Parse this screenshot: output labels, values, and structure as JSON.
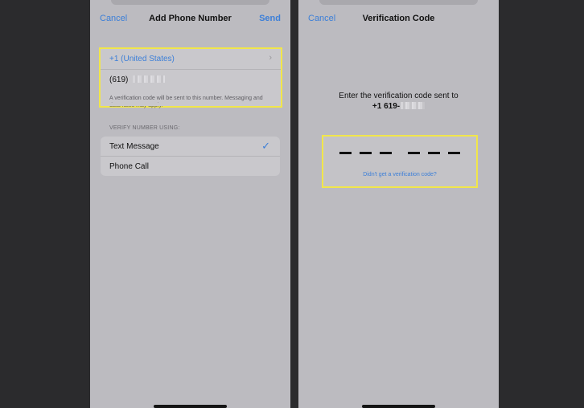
{
  "left_screen": {
    "nav": {
      "cancel": "Cancel",
      "title": "Add Phone Number",
      "send": "Send"
    },
    "country": {
      "label": "+1 (United States)",
      "chevron": "›"
    },
    "phone": {
      "prefix": "(619)"
    },
    "notice": "A verification code will be sent to this number. Messaging and data rates may apply.",
    "verify_header": "VERIFY NUMBER USING:",
    "options": [
      {
        "label": "Text Message",
        "selected": true
      },
      {
        "label": "Phone Call",
        "selected": false
      }
    ],
    "check_glyph": "✓"
  },
  "right_screen": {
    "nav": {
      "cancel": "Cancel",
      "title": "Verification Code"
    },
    "instruction": "Enter the verification code sent to",
    "number_prefix": "+1 619-",
    "code_digits_entered": 0,
    "resend_link": "Didn't get a verification code?"
  },
  "colors": {
    "accent": "#3c7fd8",
    "highlight": "#f1e64a",
    "background": "#2b2b2d",
    "panel": "#bcbbc0"
  }
}
